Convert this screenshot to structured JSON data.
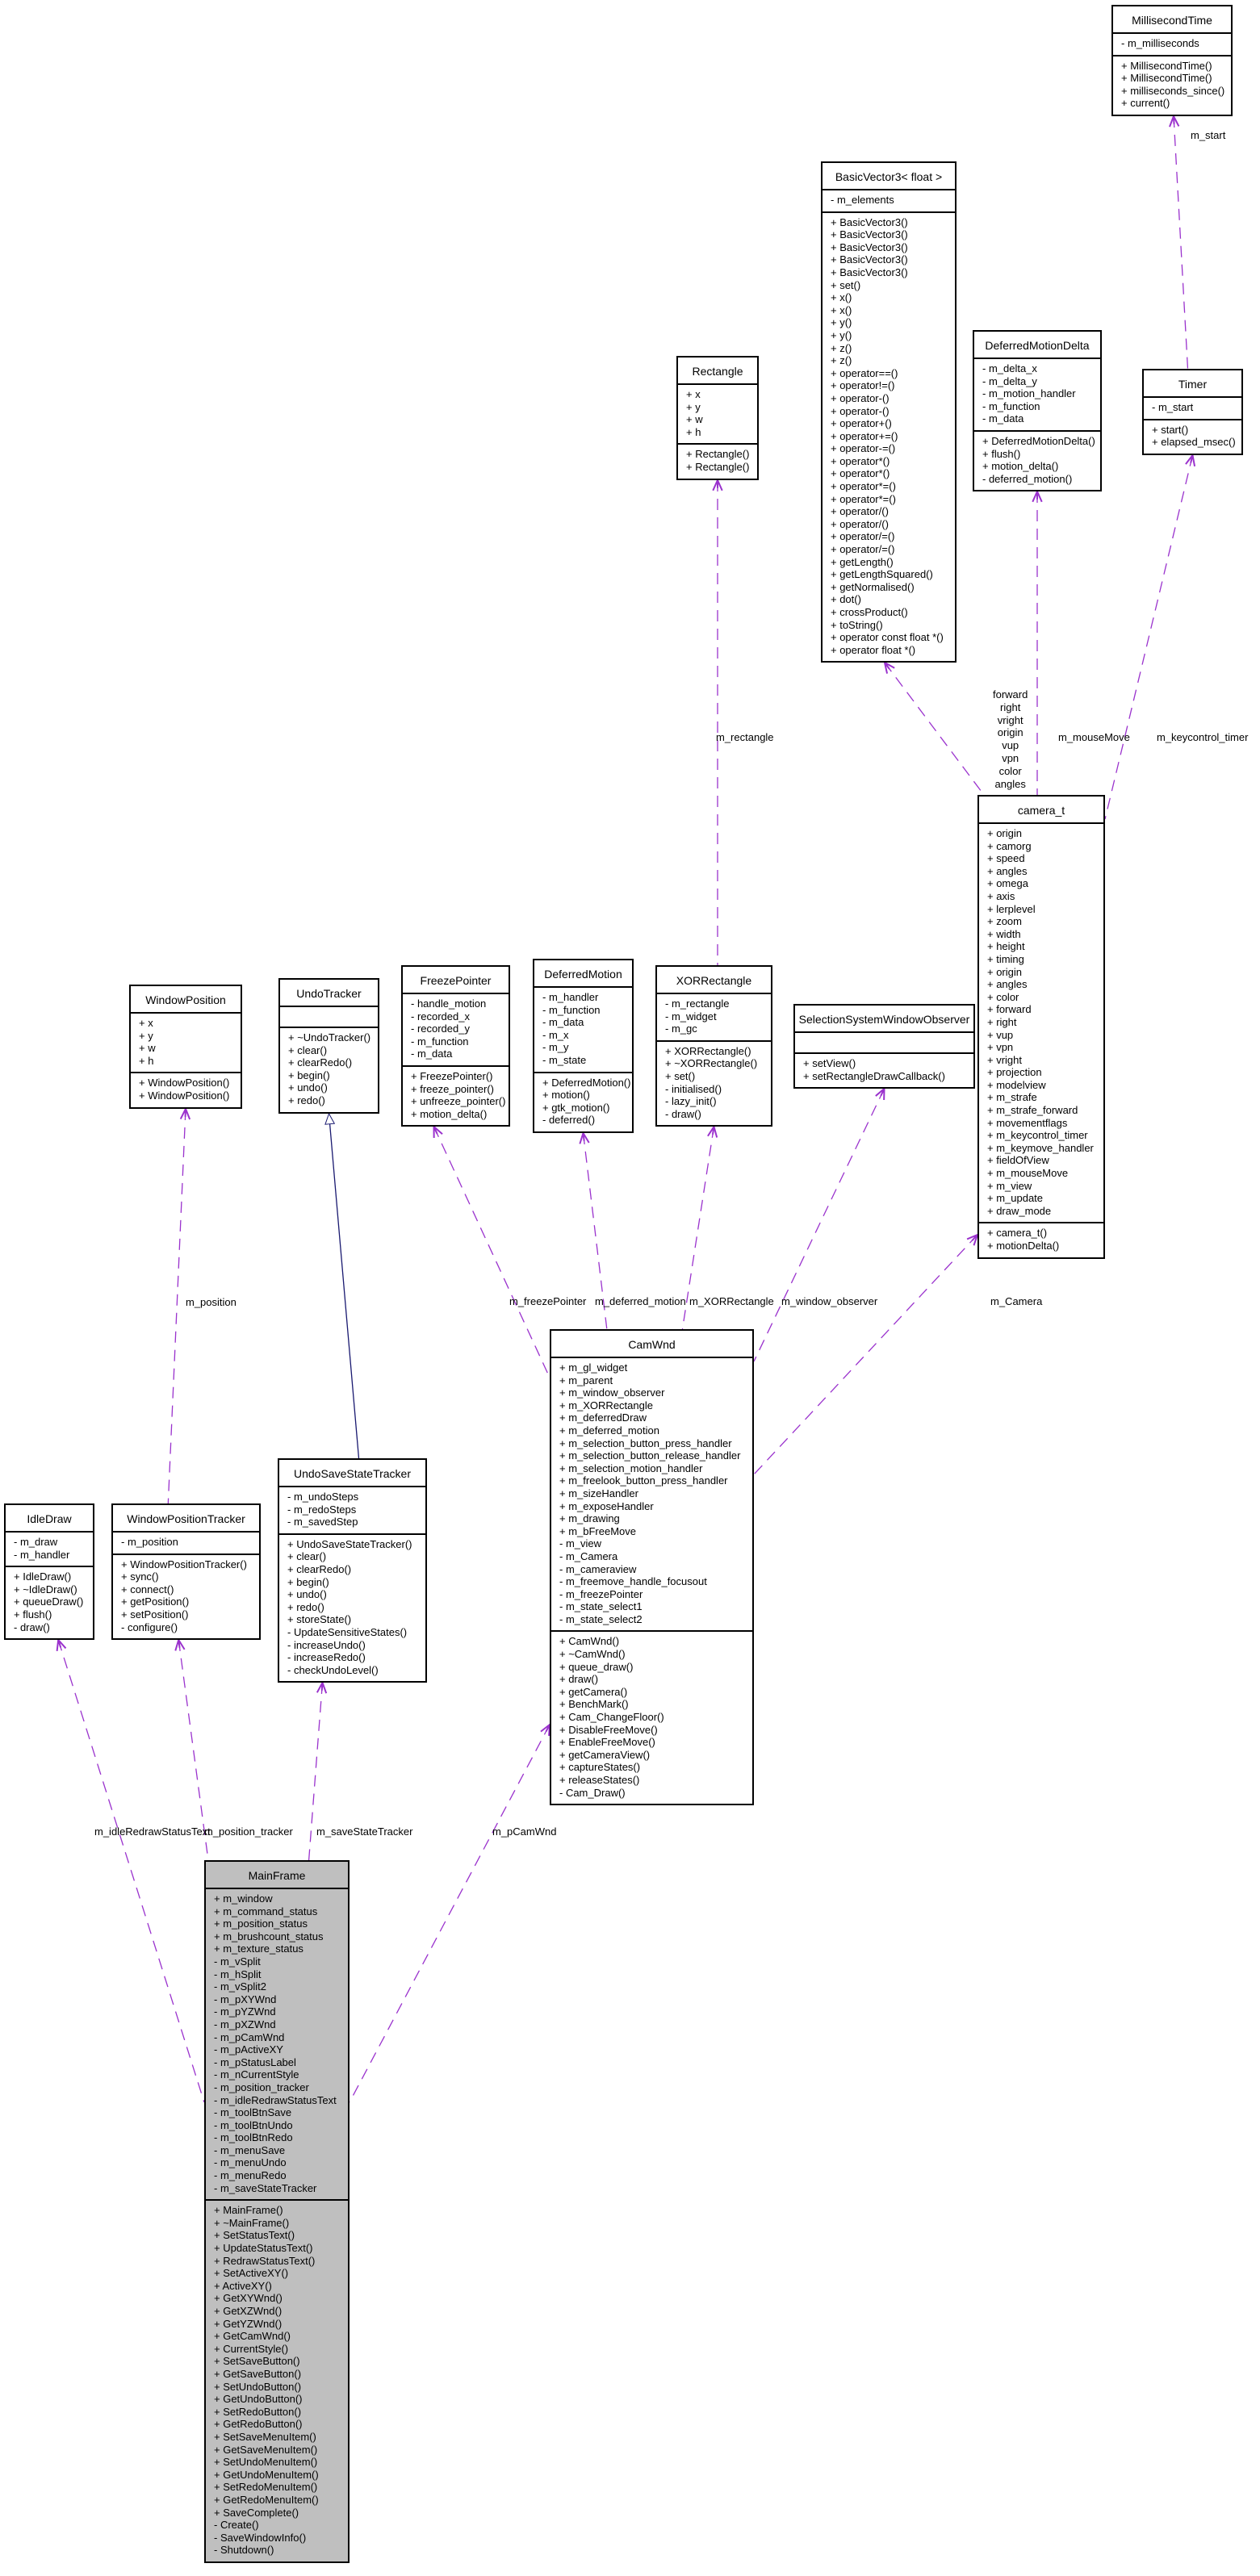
{
  "diagram": {
    "type": "uml-collaboration",
    "root_class": "MainFrame"
  },
  "classes": {
    "millisecond_time": {
      "name": "MillisecondTime",
      "attributes": [
        "- m_milliseconds"
      ],
      "methods": [
        "+ MillisecondTime()",
        "+ MillisecondTime()",
        "+ milliseconds_since()",
        "+ current()"
      ]
    },
    "basic_vector3": {
      "name": "BasicVector3< float >",
      "attributes": [
        "- m_elements"
      ],
      "methods": [
        "+ BasicVector3()",
        "+ BasicVector3()",
        "+ BasicVector3()",
        "+ BasicVector3()",
        "+ BasicVector3()",
        "+ set()",
        "+ x()",
        "+ x()",
        "+ y()",
        "+ y()",
        "+ z()",
        "+ z()",
        "+ operator==()",
        "+ operator!=()",
        "+ operator-()",
        "+ operator-()",
        "+ operator+()",
        "+ operator+=()",
        "+ operator-=()",
        "+ operator*()",
        "+ operator*()",
        "+ operator*=()",
        "+ operator*=()",
        "+ operator/()",
        "+ operator/()",
        "+ operator/=()",
        "+ operator/=()",
        "+ getLength()",
        "+ getLengthSquared()",
        "+ getNormalised()",
        "+ dot()",
        "+ crossProduct()",
        "+ toString()",
        "+ operator const float *()",
        "+ operator float *()"
      ]
    },
    "deferred_motion_delta": {
      "name": "DeferredMotionDelta",
      "attributes": [
        "- m_delta_x",
        "- m_delta_y",
        "- m_motion_handler",
        "- m_function",
        "- m_data"
      ],
      "methods": [
        "+ DeferredMotionDelta()",
        "+ flush()",
        "+ motion_delta()",
        "- deferred_motion()"
      ]
    },
    "timer": {
      "name": "Timer",
      "attributes": [
        "- m_start"
      ],
      "methods": [
        "+ start()",
        "+ elapsed_msec()"
      ]
    },
    "rectangle": {
      "name": "Rectangle",
      "attributes": [
        "+ x",
        "+ y",
        "+ w",
        "+ h"
      ],
      "methods": [
        "+ Rectangle()",
        "+ Rectangle()"
      ]
    },
    "camera_t": {
      "name": "camera_t",
      "attributes": [
        "+ origin",
        "+ camorg",
        "+ speed",
        "+ angles",
        "+ omega",
        "+ axis",
        "+ lerplevel",
        "+ zoom",
        "+ width",
        "+ height",
        "+ timing",
        "+ origin",
        "+ angles",
        "+ color",
        "+ forward",
        "+ right",
        "+ vup",
        "+ vpn",
        "+ vright",
        "+ projection",
        "+ modelview",
        "+ m_strafe",
        "+ m_strafe_forward",
        "+ movementflags",
        "+ m_keycontrol_timer",
        "+ m_keymove_handler",
        "+ fieldOfView",
        "+ m_mouseMove",
        "+ m_view",
        "+ m_update",
        "+ draw_mode"
      ],
      "methods": [
        "+ camera_t()",
        "+ motionDelta()"
      ]
    },
    "window_position": {
      "name": "WindowPosition",
      "attributes": [
        "+ x",
        "+ y",
        "+ w",
        "+ h"
      ],
      "methods": [
        "+ WindowPosition()",
        "+ WindowPosition()"
      ]
    },
    "undo_tracker": {
      "name": "UndoTracker",
      "attributes": [],
      "methods": [
        "+ ~UndoTracker()",
        "+ clear()",
        "+ clearRedo()",
        "+ begin()",
        "+ undo()",
        "+ redo()"
      ]
    },
    "freeze_pointer": {
      "name": "FreezePointer",
      "attributes": [
        "- handle_motion",
        "- recorded_x",
        "- recorded_y",
        "- m_function",
        "- m_data"
      ],
      "methods": [
        "+ FreezePointer()",
        "+ freeze_pointer()",
        "+ unfreeze_pointer()",
        "+ motion_delta()"
      ]
    },
    "deferred_motion": {
      "name": "DeferredMotion",
      "attributes": [
        "- m_handler",
        "- m_function",
        "- m_data",
        "- m_x",
        "- m_y",
        "- m_state"
      ],
      "methods": [
        "+ DeferredMotion()",
        "+ motion()",
        "+ gtk_motion()",
        "- deferred()"
      ]
    },
    "xor_rectangle": {
      "name": "XORRectangle",
      "attributes": [
        "- m_rectangle",
        "- m_widget",
        "- m_gc"
      ],
      "methods": [
        "+ XORRectangle()",
        "+ ~XORRectangle()",
        "+ set()",
        "- initialised()",
        "- lazy_init()",
        "- draw()"
      ]
    },
    "selection_system_window_observer": {
      "name": "SelectionSystemWindowObserver",
      "attributes": [],
      "methods": [
        "+ setView()",
        "+ setRectangleDrawCallback()"
      ]
    },
    "cam_wnd": {
      "name": "CamWnd",
      "attributes": [
        "+ m_gl_widget",
        "+ m_parent",
        "+ m_window_observer",
        "+ m_XORRectangle",
        "+ m_deferredDraw",
        "+ m_deferred_motion",
        "+ m_selection_button_press_handler",
        "+ m_selection_button_release_handler",
        "+ m_selection_motion_handler",
        "+ m_freelook_button_press_handler",
        "+ m_sizeHandler",
        "+ m_exposeHandler",
        "+ m_drawing",
        "+ m_bFreeMove",
        "- m_view",
        "- m_Camera",
        "- m_cameraview",
        "- m_freemove_handle_focusout",
        "- m_freezePointer",
        "- m_state_select1",
        "- m_state_select2"
      ],
      "methods": [
        "+ CamWnd()",
        "+ ~CamWnd()",
        "+ queue_draw()",
        "+ draw()",
        "+ getCamera()",
        "+ BenchMark()",
        "+ Cam_ChangeFloor()",
        "+ DisableFreeMove()",
        "+ EnableFreeMove()",
        "+ getCameraView()",
        "+ captureStates()",
        "+ releaseStates()",
        "- Cam_Draw()"
      ]
    },
    "idle_draw": {
      "name": "IdleDraw",
      "attributes": [
        "- m_draw",
        "- m_handler"
      ],
      "methods": [
        "+ IdleDraw()",
        "+ ~IdleDraw()",
        "+ queueDraw()",
        "+ flush()",
        "- draw()"
      ]
    },
    "window_position_tracker": {
      "name": "WindowPositionTracker",
      "attributes": [
        "- m_position"
      ],
      "methods": [
        "+ WindowPositionTracker()",
        "+ sync()",
        "+ connect()",
        "+ getPosition()",
        "+ setPosition()",
        "- configure()"
      ]
    },
    "undo_save_state_tracker": {
      "name": "UndoSaveStateTracker",
      "attributes": [
        "- m_undoSteps",
        "- m_redoSteps",
        "- m_savedStep"
      ],
      "methods": [
        "+ UndoSaveStateTracker()",
        "+ clear()",
        "+ clearRedo()",
        "+ begin()",
        "+ undo()",
        "+ redo()",
        "+ storeState()",
        "- UpdateSensitiveStates()",
        "- increaseUndo()",
        "- increaseRedo()",
        "- checkUndoLevel()"
      ]
    },
    "main_frame": {
      "name": "MainFrame",
      "attributes": [
        "+ m_window",
        "+ m_command_status",
        "+ m_position_status",
        "+ m_brushcount_status",
        "+ m_texture_status",
        "- m_vSplit",
        "- m_hSplit",
        "- m_vSplit2",
        "- m_pXYWnd",
        "- m_pYZWnd",
        "- m_pXZWnd",
        "- m_pCamWnd",
        "- m_pActiveXY",
        "- m_pStatusLabel",
        "- m_nCurrentStyle",
        "- m_position_tracker",
        "- m_idleRedrawStatusText",
        "- m_toolBtnSave",
        "- m_toolBtnUndo",
        "- m_toolBtnRedo",
        "- m_menuSave",
        "- m_menuUndo",
        "- m_menuRedo",
        "- m_saveStateTracker"
      ],
      "methods": [
        "+ MainFrame()",
        "+ ~MainFrame()",
        "+ SetStatusText()",
        "+ UpdateStatusText()",
        "+ RedrawStatusText()",
        "+ SetActiveXY()",
        "+ ActiveXY()",
        "+ GetXYWnd()",
        "+ GetXZWnd()",
        "+ GetYZWnd()",
        "+ GetCamWnd()",
        "+ CurrentStyle()",
        "+ SetSaveButton()",
        "+ GetSaveButton()",
        "+ SetUndoButton()",
        "+ GetUndoButton()",
        "+ SetRedoButton()",
        "+ GetRedoButton()",
        "+ SetSaveMenuItem()",
        "+ GetSaveMenuItem()",
        "+ SetUndoMenuItem()",
        "+ GetUndoMenuItem()",
        "+ SetRedoMenuItem()",
        "+ GetRedoMenuItem()",
        "+ SaveComplete()",
        "- Create()",
        "- SaveWindowInfo()",
        "- Shutdown()"
      ]
    }
  },
  "edge_labels": {
    "m_start": "m_start",
    "m_rectangle": "m_rectangle",
    "vector_members": "forward\nright\nvright\norigin\nvup\nvpn\ncolor\nangles",
    "m_mouseMove": "m_mouseMove",
    "m_keycontrol_timer": "m_keycontrol_timer",
    "m_position": "m_position",
    "m_freezePointer": "m_freezePointer",
    "m_deferred_motion": "m_deferred_motion",
    "m_XORRectangle": "m_XORRectangle",
    "m_window_observer": "m_window_observer",
    "m_Camera": "m_Camera",
    "m_idleRedrawStatusText": "m_idleRedrawStatusText",
    "m_position_tracker": "m_position_tracker",
    "m_saveStateTracker": "m_saveStateTracker",
    "m_pCamWnd": "m_pCamWnd"
  },
  "colors": {
    "usage_edge": "#9a32cd",
    "inheritance_edge": "#191970",
    "main_class_fill": "#bfbfbf",
    "class_fill": "#ffffff",
    "border": "#000000"
  }
}
